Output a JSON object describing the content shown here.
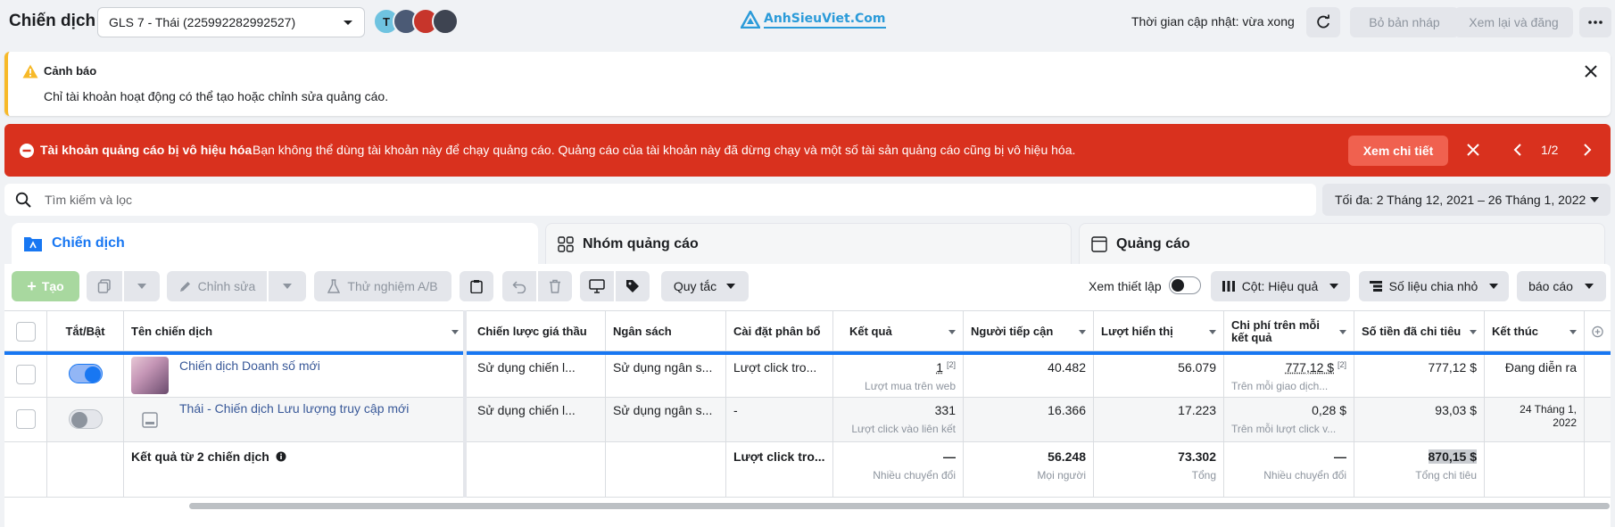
{
  "header": {
    "title": "Chiến dịch",
    "account": "GLS 7 - Thái (225992282992527)",
    "avatar_initial": "T",
    "logo_text": "AnhSieuViet.Com",
    "update_time": "Thời gian cập nhật: vừa xong",
    "discard_label": "Bỏ bản nháp",
    "review_label": "Xem lại và đăng"
  },
  "warning": {
    "title": "Cảnh báo",
    "body": "Chỉ tài khoản hoạt động có thể tạo hoặc chỉnh sửa quảng cáo."
  },
  "alert": {
    "title": "Tài khoản quảng cáo bị vô hiệu hóa",
    "body": "Bạn không thể dùng tài khoản này để chạy quảng cáo. Quảng cáo của tài khoản này đã dừng chạy và một số tài sản quảng cáo cũng bị vô hiệu hóa.",
    "details_label": "Xem chi tiết",
    "page": "1/2"
  },
  "search": {
    "placeholder": "Tìm kiếm và lọc",
    "date_range": "Tối đa: 2 Tháng 12, 2021 – 26 Tháng 1, 2022"
  },
  "tabs": [
    {
      "label": "Chiến dịch"
    },
    {
      "label": "Nhóm quảng cáo"
    },
    {
      "label": "Quảng cáo"
    }
  ],
  "toolbar": {
    "create": "Tạo",
    "edit": "Chỉnh sửa",
    "ab_test": "Thử nghiệm A/B",
    "rules": "Quy tắc",
    "view_setup": "Xem thiết lập",
    "columns": "Cột: Hiệu quả",
    "breakdown": "Số liệu chia nhỏ",
    "report": "báo cáo"
  },
  "columns": {
    "toggle": "Tắt/Bật",
    "name": "Tên chiến dịch",
    "bid": "Chiến lược giá thầu",
    "budget": "Ngân sách",
    "attribution": "Cài đặt phân bổ",
    "results": "Kết quả",
    "reach": "Người tiếp cận",
    "impressions": "Lượt hiển thị",
    "cpr": "Chi phí trên mỗi kết quả",
    "spent": "Số tiền đã chi tiêu",
    "ends": "Kết thúc"
  },
  "rows": [
    {
      "name": "Chiến dịch Doanh số mới",
      "on": true,
      "bid": "Sử dụng chiến l...",
      "budget": "Sử dụng ngân s...",
      "attribution": "Lượt click tro...",
      "results": "1",
      "results_note": "[2]",
      "results_sub": "Lượt mua trên web",
      "reach": "40.482",
      "impressions": "56.079",
      "cpr": "777,12 $",
      "cpr_note": "[2]",
      "cpr_sub": "Trên mỗi giao dịch...",
      "spent": "777,12 $",
      "ends": "Đang diễn ra"
    },
    {
      "name": "Thái - Chiến dịch Lưu lượng truy cập mới",
      "on": false,
      "bid": "Sử dụng chiến l...",
      "budget": "Sử dụng ngân s...",
      "attribution": "-",
      "results": "331",
      "results_sub": "Lượt click vào liên kết",
      "reach": "16.366",
      "impressions": "17.223",
      "cpr": "0,28 $",
      "cpr_sub": "Trên mỗi lượt click v...",
      "spent": "93,03 $",
      "ends": "24 Tháng 1, 2022"
    }
  ],
  "totals": {
    "label": "Kết quả từ 2 chiến dịch",
    "attribution": "Lượt click tro...",
    "results": "—",
    "results_sub": "Nhiều chuyển đổi",
    "reach": "56.248",
    "reach_sub": "Mọi người",
    "impressions": "73.302",
    "impressions_sub": "Tổng",
    "cpr": "—",
    "cpr_sub": "Nhiều chuyển đổi",
    "spent": "870,15 $",
    "spent_sub": "Tổng chi tiêu"
  },
  "colors": {
    "brand": "#1877f2",
    "alert": "#d9311e",
    "warning": "#f7b928",
    "create": "#a8d89f"
  }
}
